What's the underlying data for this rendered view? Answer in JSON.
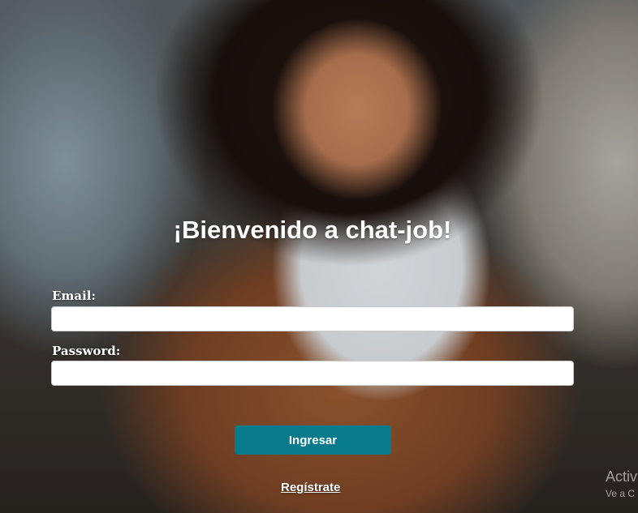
{
  "login": {
    "title": "¡Bienvenido a chat-job!",
    "email_label": "Email:",
    "email_value": "",
    "email_placeholder": "",
    "password_label": "Password:",
    "password_value": "",
    "password_placeholder": "",
    "submit_label": "Ingresar",
    "register_label": "Regístrate"
  },
  "watermark": {
    "line1": "Activ",
    "line2": "Ve a C"
  },
  "colors": {
    "button": "#077b8c",
    "text": "#ffffff"
  }
}
